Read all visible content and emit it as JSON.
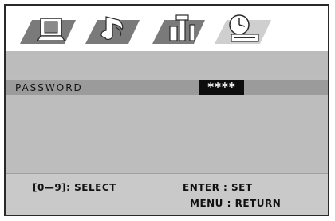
{
  "menu": {
    "tabs": [
      {
        "icon": "tv-icon"
      },
      {
        "icon": "music-note-icon"
      },
      {
        "icon": "tools-icon"
      },
      {
        "icon": "clock-icon"
      }
    ]
  },
  "password": {
    "label": "PASSWORD",
    "value": "****"
  },
  "footer": {
    "select_hint": "[0—9]: SELECT",
    "set_hint": "ENTER : SET",
    "return_hint": "MENU : RETURN"
  },
  "colors": {
    "icon_fill": "#7a7a7a",
    "background_gray": "#bdbdbd",
    "row_highlight": "#9b9b9b",
    "value_box": "#0d0d0d"
  }
}
